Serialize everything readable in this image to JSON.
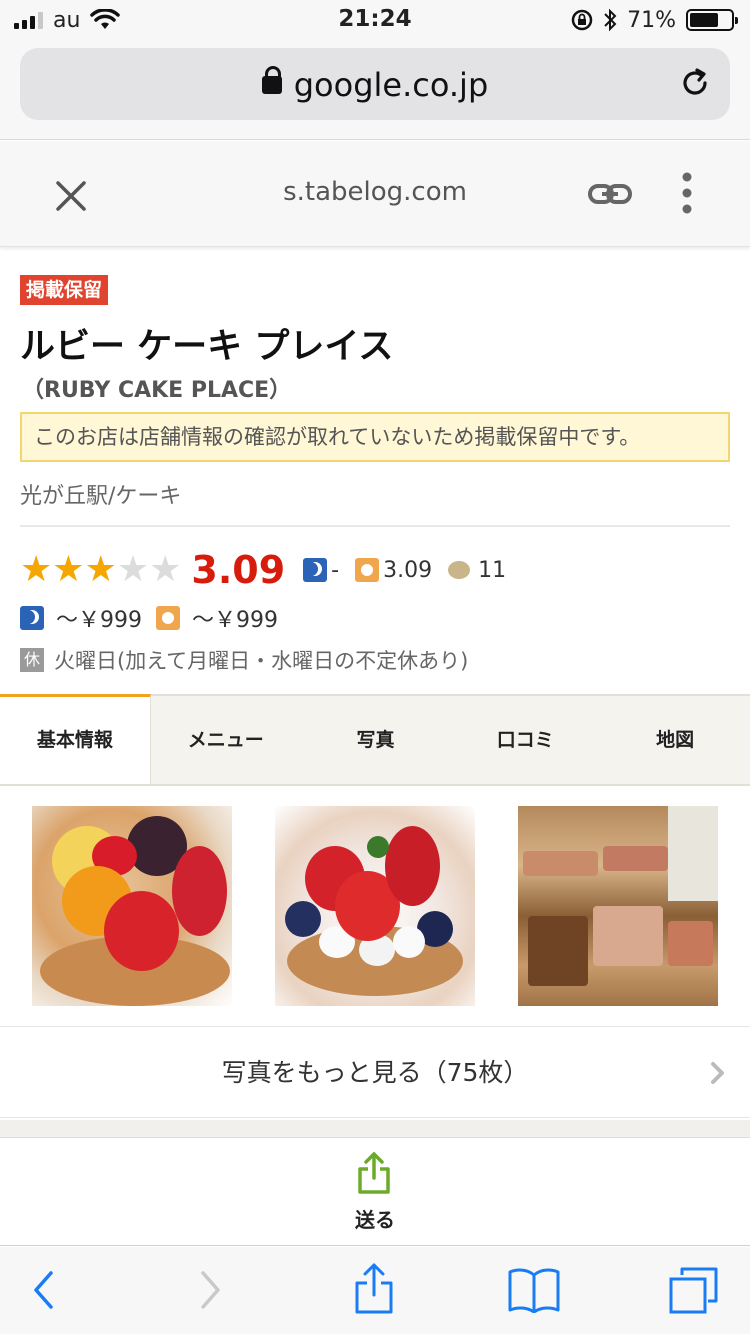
{
  "status_bar": {
    "carrier": "au",
    "time": "21:24",
    "battery_percent": "71%",
    "battery_level": 0.71,
    "signal_bars": 3
  },
  "browser": {
    "url": "google.co.jp",
    "tab_domain": "s.tabelog.com"
  },
  "shop": {
    "badge": "掲載保留",
    "name": "ルビー ケーキ プレイス",
    "name_en": "（RUBY CAKE PLACE）",
    "notice": "このお店は店舗情報の確認が取れていないため掲載保留中です。",
    "area": "光が丘駅/ケーキ",
    "rating": {
      "stars_filled": 3,
      "stars_total": 5,
      "score": "3.09",
      "dinner_score": "-",
      "lunch_score": "3.09",
      "review_count": "11"
    },
    "price": {
      "dinner": "～￥999",
      "lunch": "～￥999"
    },
    "holiday_icon": "休",
    "holiday": "火曜日(加えて月曜日・水曜日の不定休あり)"
  },
  "tabs": [
    {
      "label": "基本情報",
      "active": true
    },
    {
      "label": "メニュー",
      "active": false
    },
    {
      "label": "写真",
      "active": false
    },
    {
      "label": "口コミ",
      "active": false
    },
    {
      "label": "地図",
      "active": false
    }
  ],
  "photos": {
    "more_label": "写真をもっと見る（75枚）"
  },
  "send": {
    "label": "送る"
  },
  "colors": {
    "badge": "#e0442e",
    "score": "#d81c0c",
    "star": "#f5a600",
    "tab_accent": "#f0a41a",
    "ios_blue": "#1a7cf5",
    "send_green": "#6cab2a"
  }
}
